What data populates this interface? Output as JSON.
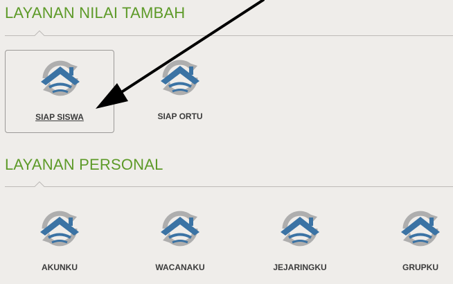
{
  "sections": [
    {
      "title": "LAYANAN NILAI TAMBAH",
      "items": [
        {
          "label": "SIAP SISWA",
          "icon": "home-sync-icon",
          "selected": true
        },
        {
          "label": "SIAP ORTU",
          "icon": "home-sync-icon",
          "selected": false
        }
      ]
    },
    {
      "title": "LAYANAN PERSONAL",
      "items": [
        {
          "label": "AKUNKU",
          "icon": "home-sync-icon",
          "selected": false
        },
        {
          "label": "WACANAKU",
          "icon": "home-sync-icon",
          "selected": false
        },
        {
          "label": "JEJARINGKU",
          "icon": "home-sync-icon",
          "selected": false
        },
        {
          "label": "GRUPKU",
          "icon": "home-sync-icon",
          "selected": false
        }
      ]
    }
  ],
  "colors": {
    "background": "#efedea",
    "section_title": "#5d9a28",
    "icon_blue": "#3b73a4",
    "icon_gray": "#aeaeae",
    "label": "#3b3b3b",
    "annotation_arrow": "#000000"
  }
}
